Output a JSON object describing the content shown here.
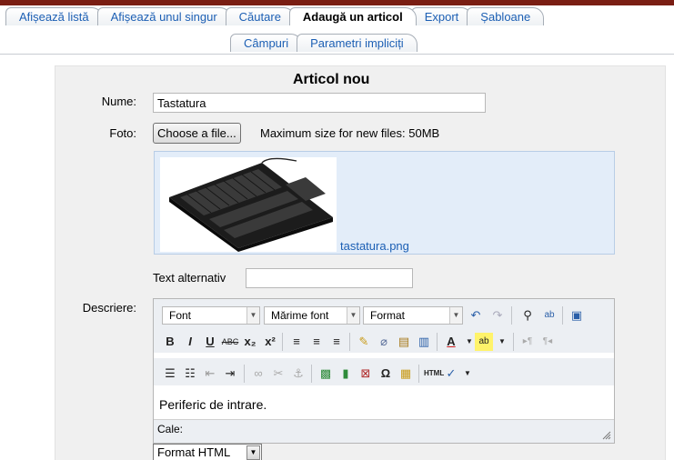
{
  "tabs_row1": [
    "Afișează listă",
    "Afișează unul singur",
    "Căutare",
    "Adaugă un articol",
    "Export",
    "Șabloane"
  ],
  "tabs_row2": [
    "Câmpuri",
    "Parametri impliciți"
  ],
  "form": {
    "title": "Articol nou",
    "name_label": "Nume:",
    "name_value": "Tastatura",
    "photo_label": "Foto:",
    "choose_file": "Choose a file...",
    "max_size": "Maximum size for new files: 50MB",
    "file_name": "tastatura.png",
    "alt_label": "Text alternativ",
    "alt_value": "",
    "desc_label": "Descriere:"
  },
  "editor": {
    "font_select": "Font",
    "size_select": "Mărime font",
    "format_select": "Format",
    "content": "Periferic de intrare.",
    "path_label": "Cale:",
    "format_html": "Format HTML"
  },
  "colors": {
    "accent_link": "#1c5fb4",
    "file_area": "#e3edf9",
    "top_bar": "#7a1e13"
  }
}
